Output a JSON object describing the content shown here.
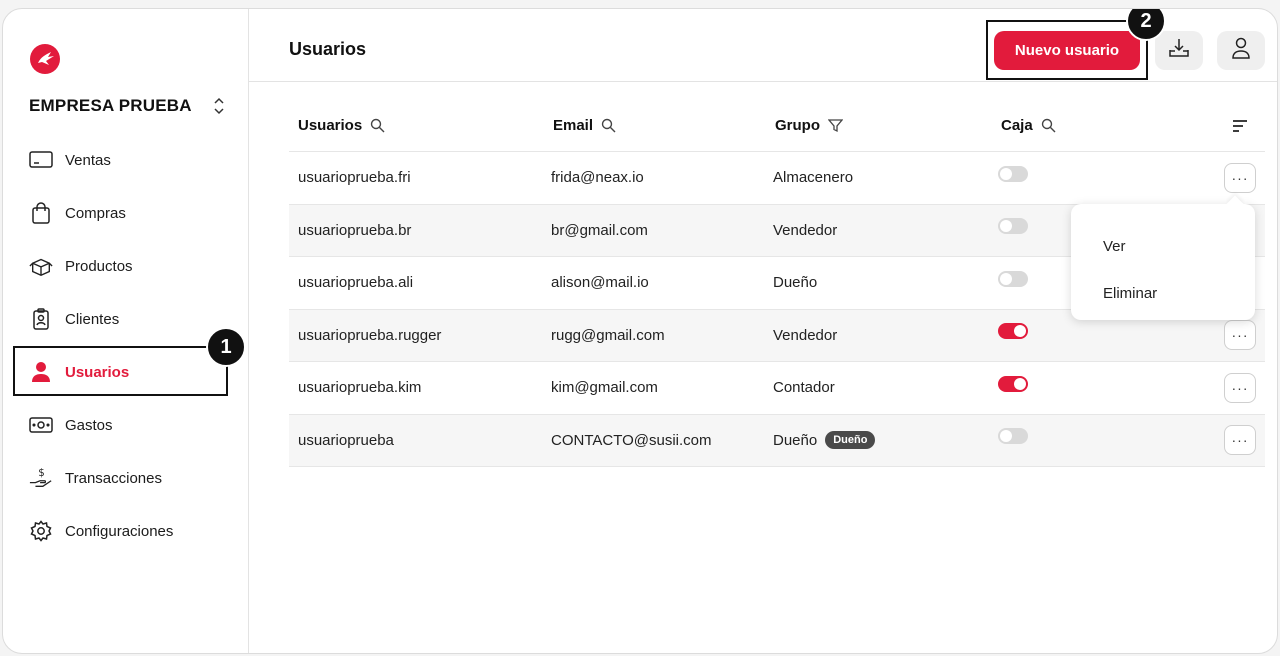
{
  "company": {
    "name": "EMPRESA PRUEBA"
  },
  "sidebar": {
    "items": [
      {
        "label": "Ventas",
        "icon": "sales-icon"
      },
      {
        "label": "Compras",
        "icon": "shopping-bag-icon"
      },
      {
        "label": "Productos",
        "icon": "box-icon"
      },
      {
        "label": "Clientes",
        "icon": "client-badge-icon"
      },
      {
        "label": "Usuarios",
        "icon": "user-icon",
        "active": true
      },
      {
        "label": "Gastos",
        "icon": "money-icon"
      },
      {
        "label": "Transacciones",
        "icon": "transactions-icon"
      },
      {
        "label": "Configuraciones",
        "icon": "gear-icon"
      }
    ]
  },
  "header": {
    "title": "Usuarios",
    "new_button": "Nuevo usuario"
  },
  "callouts": {
    "one": "1",
    "two": "2"
  },
  "table": {
    "columns": [
      "Usuarios",
      "Email",
      "Grupo",
      "Caja"
    ],
    "rows": [
      {
        "user": "usuarioprueba.fri",
        "email": "frida@neax.io",
        "group": "Almacenero",
        "caja": false
      },
      {
        "user": "usuarioprueba.br",
        "email": "br@gmail.com",
        "group": "Vendedor",
        "caja": false
      },
      {
        "user": "usuarioprueba.ali",
        "email": "alison@mail.io",
        "group": "Dueño",
        "caja": false
      },
      {
        "user": "usuarioprueba.rugger",
        "email": "rugg@gmail.com",
        "group": "Vendedor",
        "caja": true
      },
      {
        "user": "usuarioprueba.kim",
        "email": "kim@gmail.com",
        "group": "Contador",
        "caja": true
      },
      {
        "user": "usuarioprueba",
        "email": "CONTACTO@susii.com",
        "group": "Dueño",
        "caja": false,
        "badge": "Dueño"
      }
    ],
    "more_label": "···"
  },
  "row_menu": {
    "view": "Ver",
    "delete": "Eliminar"
  },
  "colors": {
    "accent": "#e21b3c",
    "toggle_off": "#d9d9d9",
    "badge_bg": "#4a4a4a"
  }
}
